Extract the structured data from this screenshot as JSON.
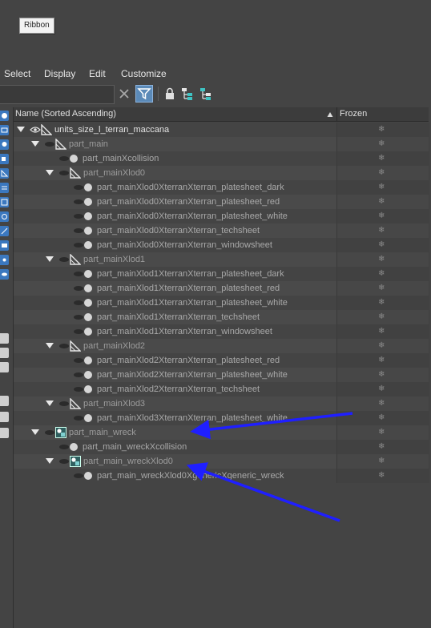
{
  "ribbon": {
    "label": "Ribbon"
  },
  "menu": {
    "items": [
      "Select",
      "Display",
      "Edit",
      "Customize"
    ]
  },
  "toolbar": {
    "search_value": "",
    "icons": [
      "clear-icon",
      "filter-icon",
      "lock-icon",
      "hierarchy-icon",
      "hierarchy-alt-icon"
    ]
  },
  "colors": {
    "accent": "#5b8ab8",
    "arrow": "#1f1fff",
    "background": "#444444"
  },
  "columns": {
    "name": "Name (Sorted Ascending)",
    "frozen": "Frozen"
  },
  "rows": [
    {
      "label": "units_size_l_terran_maccana",
      "kind": "root"
    },
    {
      "label": "part_main",
      "kind": "group"
    },
    {
      "label": "part_mainXcollision",
      "kind": "leaf"
    },
    {
      "label": "part_mainXlod0",
      "kind": "group"
    },
    {
      "label": "part_mainXlod0XterranXterran_platesheet_dark",
      "kind": "leaf"
    },
    {
      "label": "part_mainXlod0XterranXterran_platesheet_red",
      "kind": "leaf"
    },
    {
      "label": "part_mainXlod0XterranXterran_platesheet_white",
      "kind": "leaf"
    },
    {
      "label": "part_mainXlod0XterranXterran_techsheet",
      "kind": "leaf"
    },
    {
      "label": "part_mainXlod0XterranXterran_windowsheet",
      "kind": "leaf"
    },
    {
      "label": "part_mainXlod1",
      "kind": "group"
    },
    {
      "label": "part_mainXlod1XterranXterran_platesheet_dark",
      "kind": "leaf"
    },
    {
      "label": "part_mainXlod1XterranXterran_platesheet_red",
      "kind": "leaf"
    },
    {
      "label": "part_mainXlod1XterranXterran_platesheet_white",
      "kind": "leaf"
    },
    {
      "label": "part_mainXlod1XterranXterran_techsheet",
      "kind": "leaf"
    },
    {
      "label": "part_mainXlod1XterranXterran_windowsheet",
      "kind": "leaf"
    },
    {
      "label": "part_mainXlod2",
      "kind": "group"
    },
    {
      "label": "part_mainXlod2XterranXterran_platesheet_red",
      "kind": "leaf"
    },
    {
      "label": "part_mainXlod2XterranXterran_platesheet_white",
      "kind": "leaf"
    },
    {
      "label": "part_mainXlod2XterranXterran_techsheet",
      "kind": "leaf"
    },
    {
      "label": "part_mainXlod3",
      "kind": "group"
    },
    {
      "label": "part_mainXlod3XterranXterran_platesheet_white",
      "kind": "leaf"
    },
    {
      "label": "part_main_wreck",
      "kind": "wreck"
    },
    {
      "label": "part_main_wreckXcollision",
      "kind": "leaf"
    },
    {
      "label": "part_main_wreckXlod0",
      "kind": "wreck"
    },
    {
      "label": "part_main_wreckXlod0XgenericXgeneric_wreck",
      "kind": "leaf"
    }
  ]
}
